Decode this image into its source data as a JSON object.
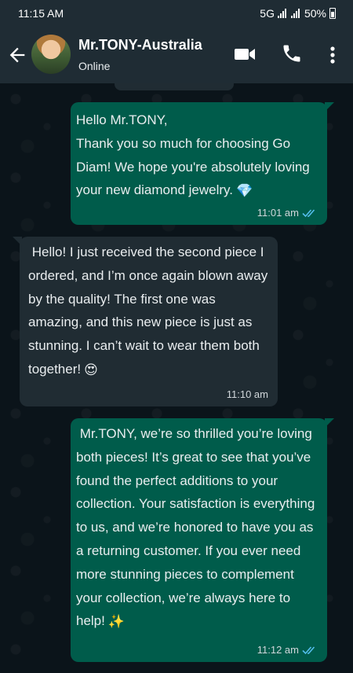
{
  "status_bar": {
    "time": "11:15 AM",
    "network": "5G",
    "battery": "50%"
  },
  "header": {
    "name": "Mr.TONY-Australia",
    "status": "Online"
  },
  "messages": [
    {
      "direction": "outgoing",
      "text": "Hello Mr.TONY,\nThank you so much for choosing Go Diam! We hope you're absolutely loving your new diamond jewelry.",
      "emoji": "💎",
      "time": "11:01 am",
      "read": true
    },
    {
      "direction": "incoming",
      "text": " Hello! I just received the second piece I ordered, and I’m once again blown away by the quality! The first one was amazing, and this new piece is just as stunning. I can’t wait to wear them both together!",
      "emoji": "😍",
      "time": "11:10 am"
    },
    {
      "direction": "outgoing",
      "text": " Mr.TONY, we’re so thrilled you’re loving both pieces! It’s great to see that you’ve found the perfect additions to your collection. Your satisfaction is everything to us, and we’re honored to have you as a returning customer. If you ever need more stunning pieces to complement your collection, we’re always here to help!",
      "emoji": "✨",
      "time": "11:12 am",
      "read": true
    }
  ],
  "colors": {
    "outgoing_bubble": "#005c4b",
    "incoming_bubble": "#202c33",
    "header": "#1f2c34",
    "read_ticks": "#53bdeb"
  },
  "icons": [
    "back-arrow-icon",
    "video-call-icon",
    "phone-icon",
    "more-vertical-icon",
    "double-check-icon"
  ]
}
